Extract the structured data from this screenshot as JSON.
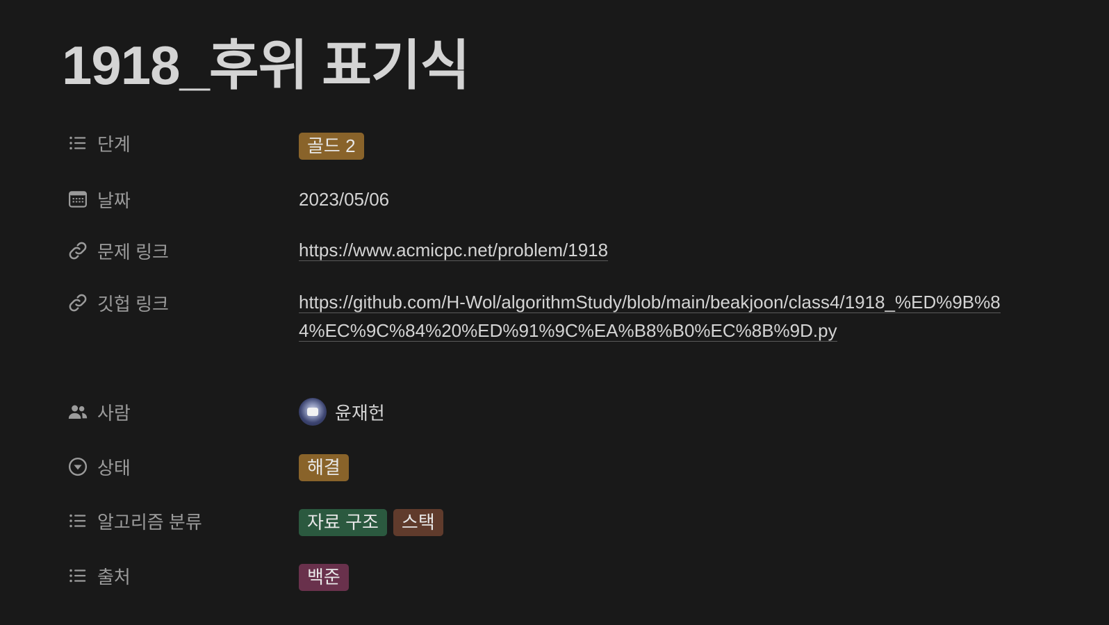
{
  "page": {
    "title": "1918_후위 표기식"
  },
  "properties": {
    "level": {
      "label": "단계",
      "icon": "list-icon",
      "tag": {
        "text": "골드 2",
        "color": "#89632a"
      }
    },
    "date": {
      "label": "날짜",
      "icon": "calendar-icon",
      "value": "2023/05/06"
    },
    "problem_link": {
      "label": "문제 링크",
      "icon": "link-icon",
      "value": "https://www.acmicpc.net/problem/1918"
    },
    "github_link": {
      "label": "깃헙 링크",
      "icon": "link-icon",
      "value": "https://github.com/H-Wol/algorithmStudy/blob/main/beakjoon/class4/1918_%ED%9B%84%EC%9C%84%20%ED%91%9C%EA%B8%B0%EC%8B%9D.py"
    },
    "person": {
      "label": "사람",
      "icon": "people-icon",
      "name": "윤재헌"
    },
    "status": {
      "label": "상태",
      "icon": "status-icon",
      "tag": {
        "text": "해결",
        "color": "#89632a"
      }
    },
    "algorithm": {
      "label": "알고리즘 분류",
      "icon": "list-icon",
      "tags": [
        {
          "text": "자료 구조",
          "color": "#2b593f"
        },
        {
          "text": "스택",
          "color": "#603b2c"
        }
      ]
    },
    "source": {
      "label": "출처",
      "icon": "list-icon",
      "tag": {
        "text": "백준",
        "color": "#69314c"
      }
    }
  }
}
